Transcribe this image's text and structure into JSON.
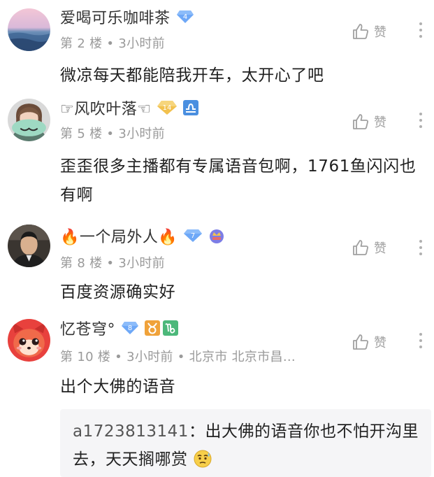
{
  "comments": [
    {
      "username": "爱喝可乐咖啡茶",
      "level": "4",
      "floor": "第 2 楼",
      "time": "3小时前",
      "text": "微凉每天都能陪我开车，太开心了吧",
      "like_label": "赞"
    },
    {
      "username": "☞风吹叶落☜",
      "level": "14",
      "floor": "第 5 楼",
      "time": "3小时前",
      "text": "歪歪很多主播都有专属语音包啊，1761鱼闪闪也有啊",
      "like_label": "赞"
    },
    {
      "username": "🔥一个局外人🔥",
      "level": "7",
      "floor": "第 8 楼",
      "time": "3小时前",
      "text": "百度资源确实好",
      "like_label": "赞"
    },
    {
      "username": "忆苍穹°",
      "level": "8",
      "floor": "第 10 楼",
      "time": "3小时前",
      "location": "北京市 北京市昌…",
      "text": "出个大佛的语音",
      "like_label": "赞"
    }
  ],
  "reply": {
    "user": "a1723813141",
    "separator": "：",
    "text": "出大佛的语音你也不怕开沟里去，天天搁哪赏"
  },
  "colors": {
    "diamond_blue": "#6ea8f7",
    "gold_badge": "#f2c14e",
    "zodiac_orange": "#f0a23a",
    "zodiac_green": "#4cb87a",
    "meta_gray": "#9a9a9a"
  }
}
